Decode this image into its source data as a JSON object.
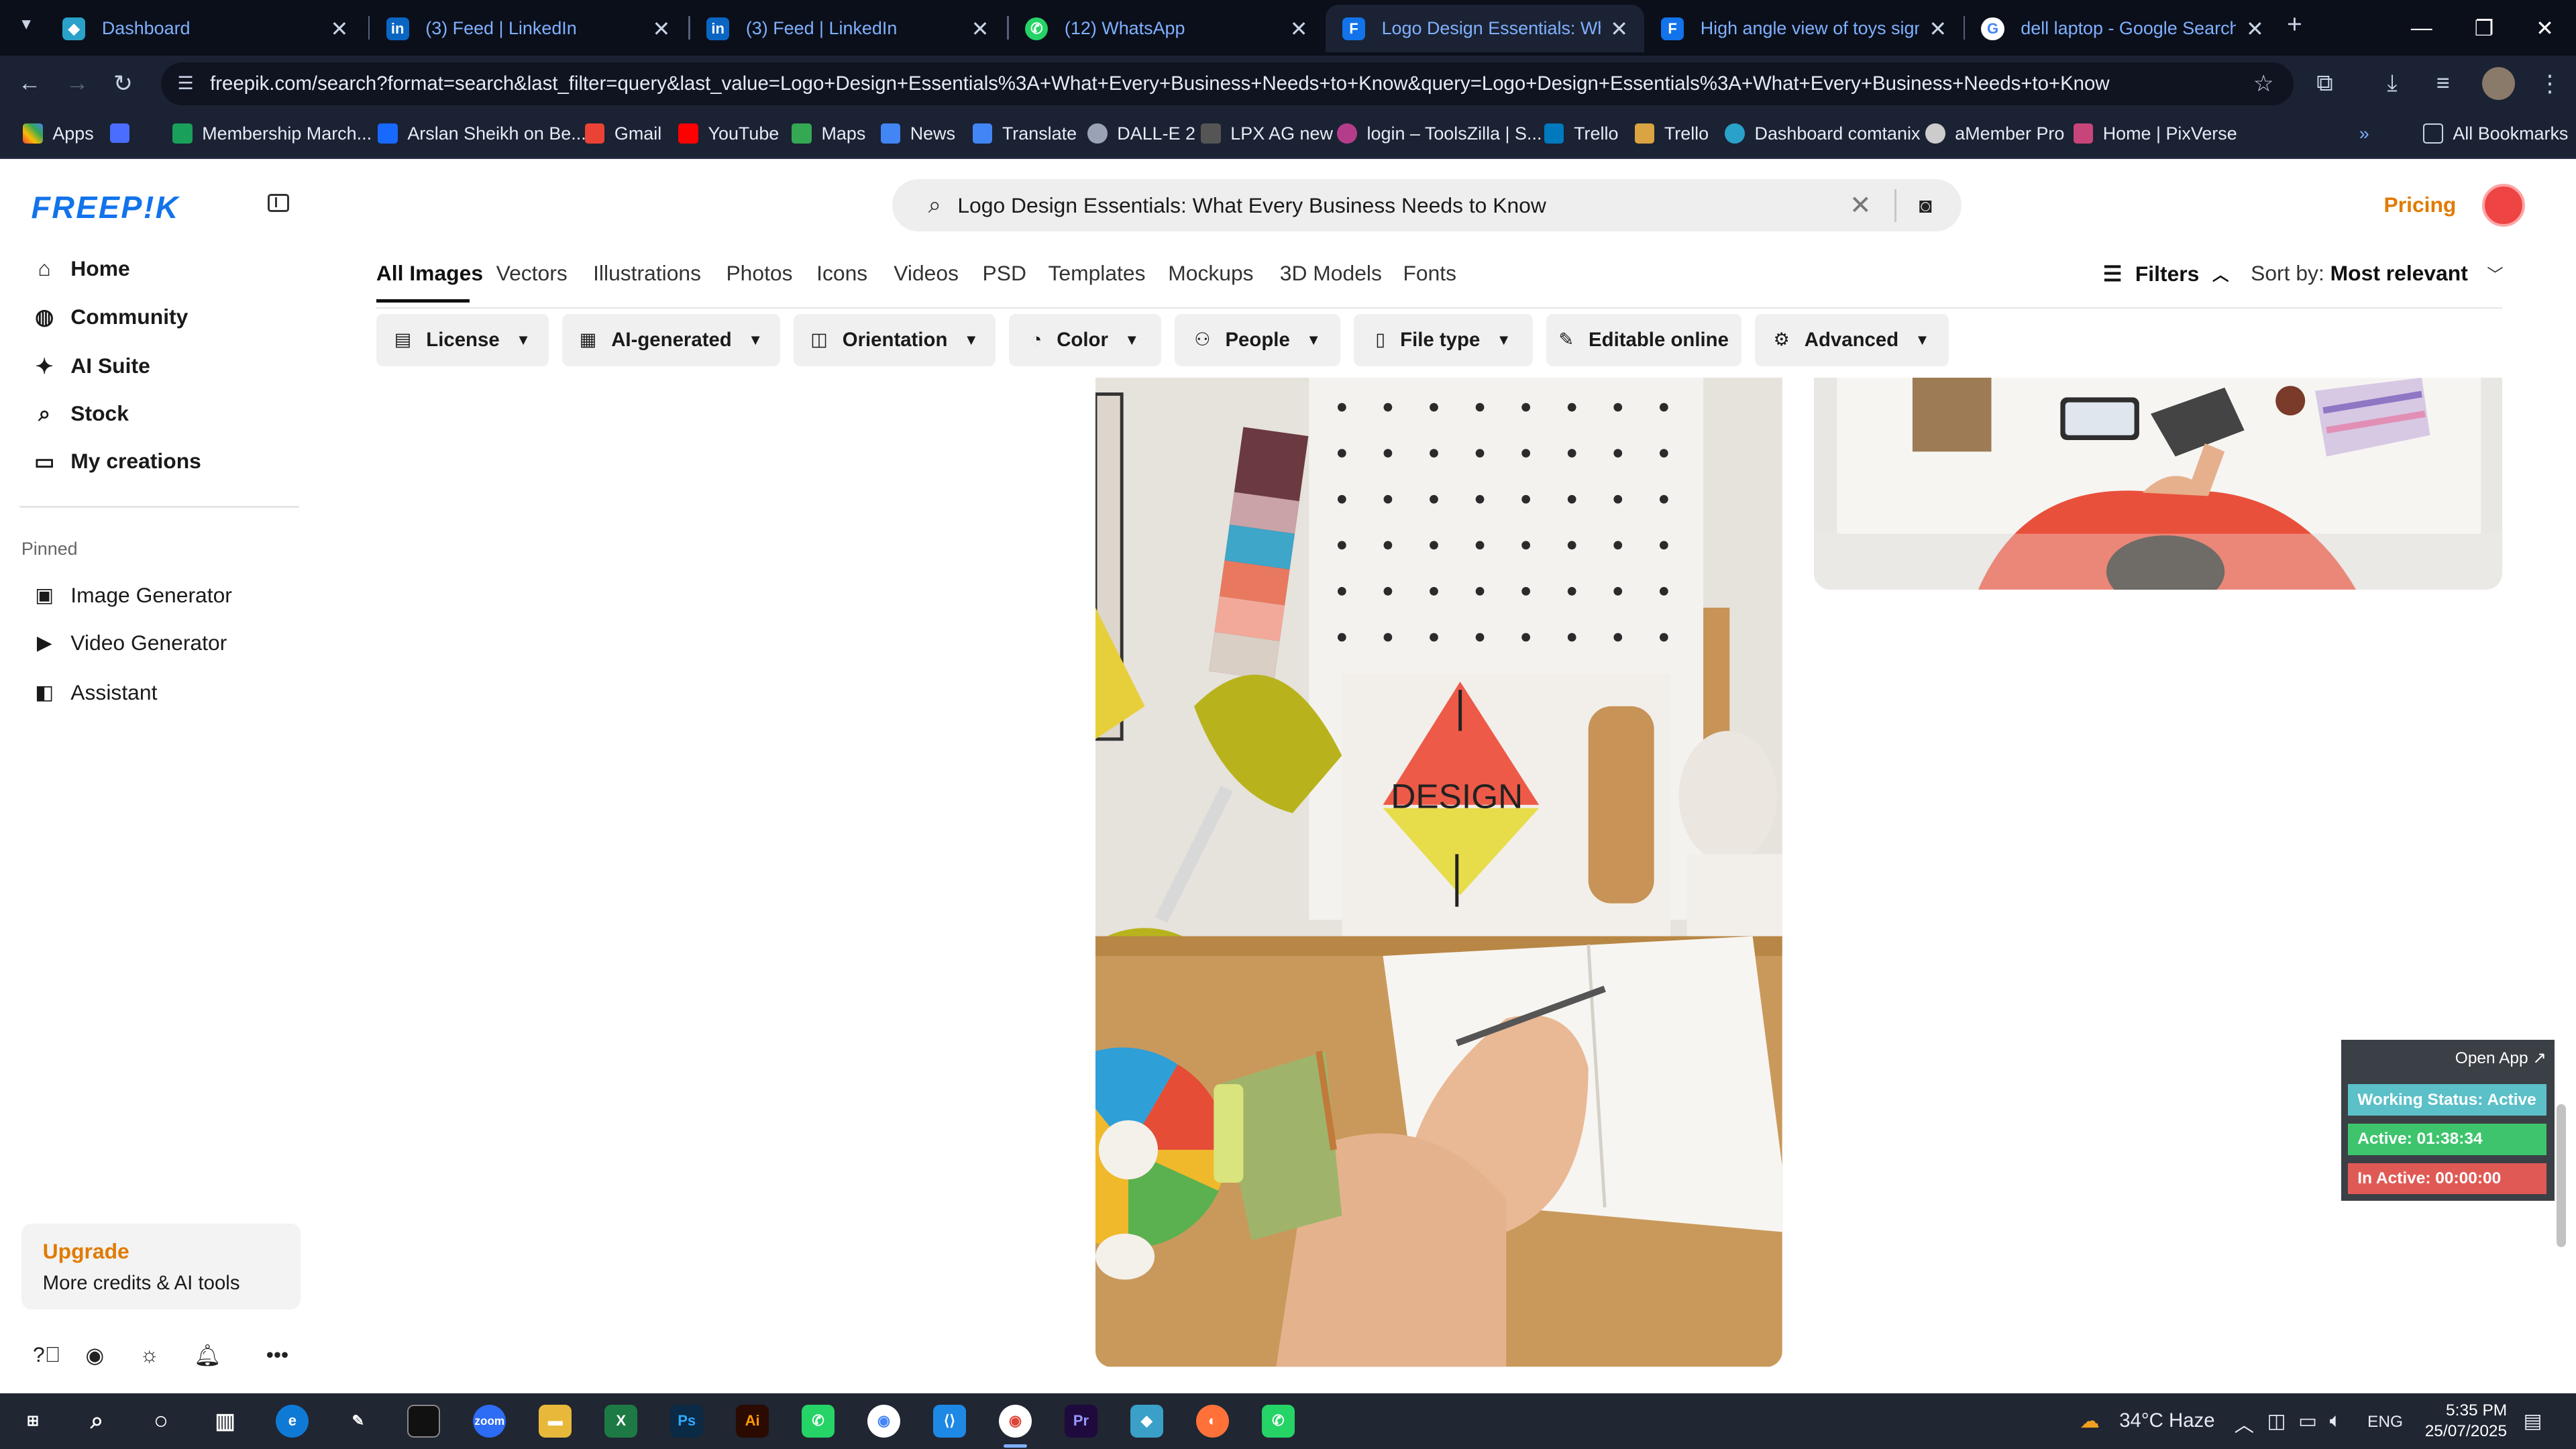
{
  "browser": {
    "tabs": [
      {
        "title": "Dashboard",
        "icon": "dashboard-icon",
        "active": false
      },
      {
        "title": "(3) Feed | LinkedIn",
        "icon": "linkedin-icon",
        "active": false
      },
      {
        "title": "(3) Feed | LinkedIn",
        "icon": "linkedin-icon",
        "active": false
      },
      {
        "title": "(12) WhatsApp",
        "icon": "whatsapp-icon",
        "active": false
      },
      {
        "title": "Logo Design Essentials: What E",
        "icon": "freepik-icon",
        "active": true
      },
      {
        "title": "High angle view of toys sign | F",
        "icon": "freepik-icon",
        "active": false
      },
      {
        "title": "dell laptop - Google Search",
        "icon": "google-icon",
        "active": false
      }
    ],
    "url": "freepik.com/search?format=search&last_filter=query&last_value=Logo+Design+Essentials%3A+What+Every+Business+Needs+to+Know&query=Logo+Design+Essentials%3A+What+Every+Business+Needs+to+Know",
    "bookmarks": [
      "Apps",
      "Membership March...",
      "Arslan Sheikh on Be...",
      "Gmail",
      "YouTube",
      "Maps",
      "News",
      "Translate",
      "DALL-E 2",
      "LPX AG new",
      "login – ToolsZilla | S...",
      "Trello",
      "Trello",
      "Dashboard comtanix",
      "aMember Pro",
      "Home | PixVerse"
    ],
    "all_bookmarks": "All Bookmarks"
  },
  "sidebar": {
    "logo": "FREEP!K",
    "nav": [
      {
        "label": "Home",
        "icon": "home-icon"
      },
      {
        "label": "Community",
        "icon": "globe-icon"
      },
      {
        "label": "AI Suite",
        "icon": "sparkle-icon"
      },
      {
        "label": "Stock",
        "icon": "search-icon"
      },
      {
        "label": "My creations",
        "icon": "folder-icon"
      }
    ],
    "pinned_label": "Pinned",
    "pinned": [
      {
        "label": "Image Generator",
        "icon": "image-icon"
      },
      {
        "label": "Video Generator",
        "icon": "video-icon"
      },
      {
        "label": "Assistant",
        "icon": "assistant-icon"
      }
    ],
    "upgrade_title": "Upgrade",
    "upgrade_sub": "More credits & AI tools"
  },
  "header": {
    "search_query": "Logo Design Essentials: What Every Business Needs to Know",
    "pricing": "Pricing"
  },
  "categories": [
    "All Images",
    "Vectors",
    "Illustrations",
    "Photos",
    "Icons",
    "Videos",
    "PSD",
    "Templates",
    "Mockups",
    "3D Models",
    "Fonts"
  ],
  "filters_label": "Filters",
  "sort": {
    "label": "Sort by:",
    "value": "Most relevant"
  },
  "chips": [
    {
      "label": "License",
      "icon": "license-icon"
    },
    {
      "label": "AI-generated",
      "icon": "ai-icon"
    },
    {
      "label": "Orientation",
      "icon": "orientation-icon"
    },
    {
      "label": "Color",
      "icon": "palette-icon"
    },
    {
      "label": "People",
      "icon": "people-icon"
    },
    {
      "label": "File type",
      "icon": "file-icon"
    },
    {
      "label": "Editable online",
      "icon": "pen-icon"
    },
    {
      "label": "Advanced",
      "icon": "gear-icon"
    }
  ],
  "results": {
    "design_text": "DESIGN"
  },
  "widget": {
    "open_app": "Open App ↗",
    "working_status": "Working Status: Active",
    "active": "Active: 01:38:34",
    "inactive": "In Active: 00:00:00",
    "colors": {
      "status": "#5bc0c8",
      "active": "#3ec46d",
      "inactive": "#e05a55"
    }
  },
  "taskbar": {
    "weather": "34°C  Haze",
    "language": "ENG",
    "time": "5:35 PM",
    "date": "25/07/2025"
  }
}
